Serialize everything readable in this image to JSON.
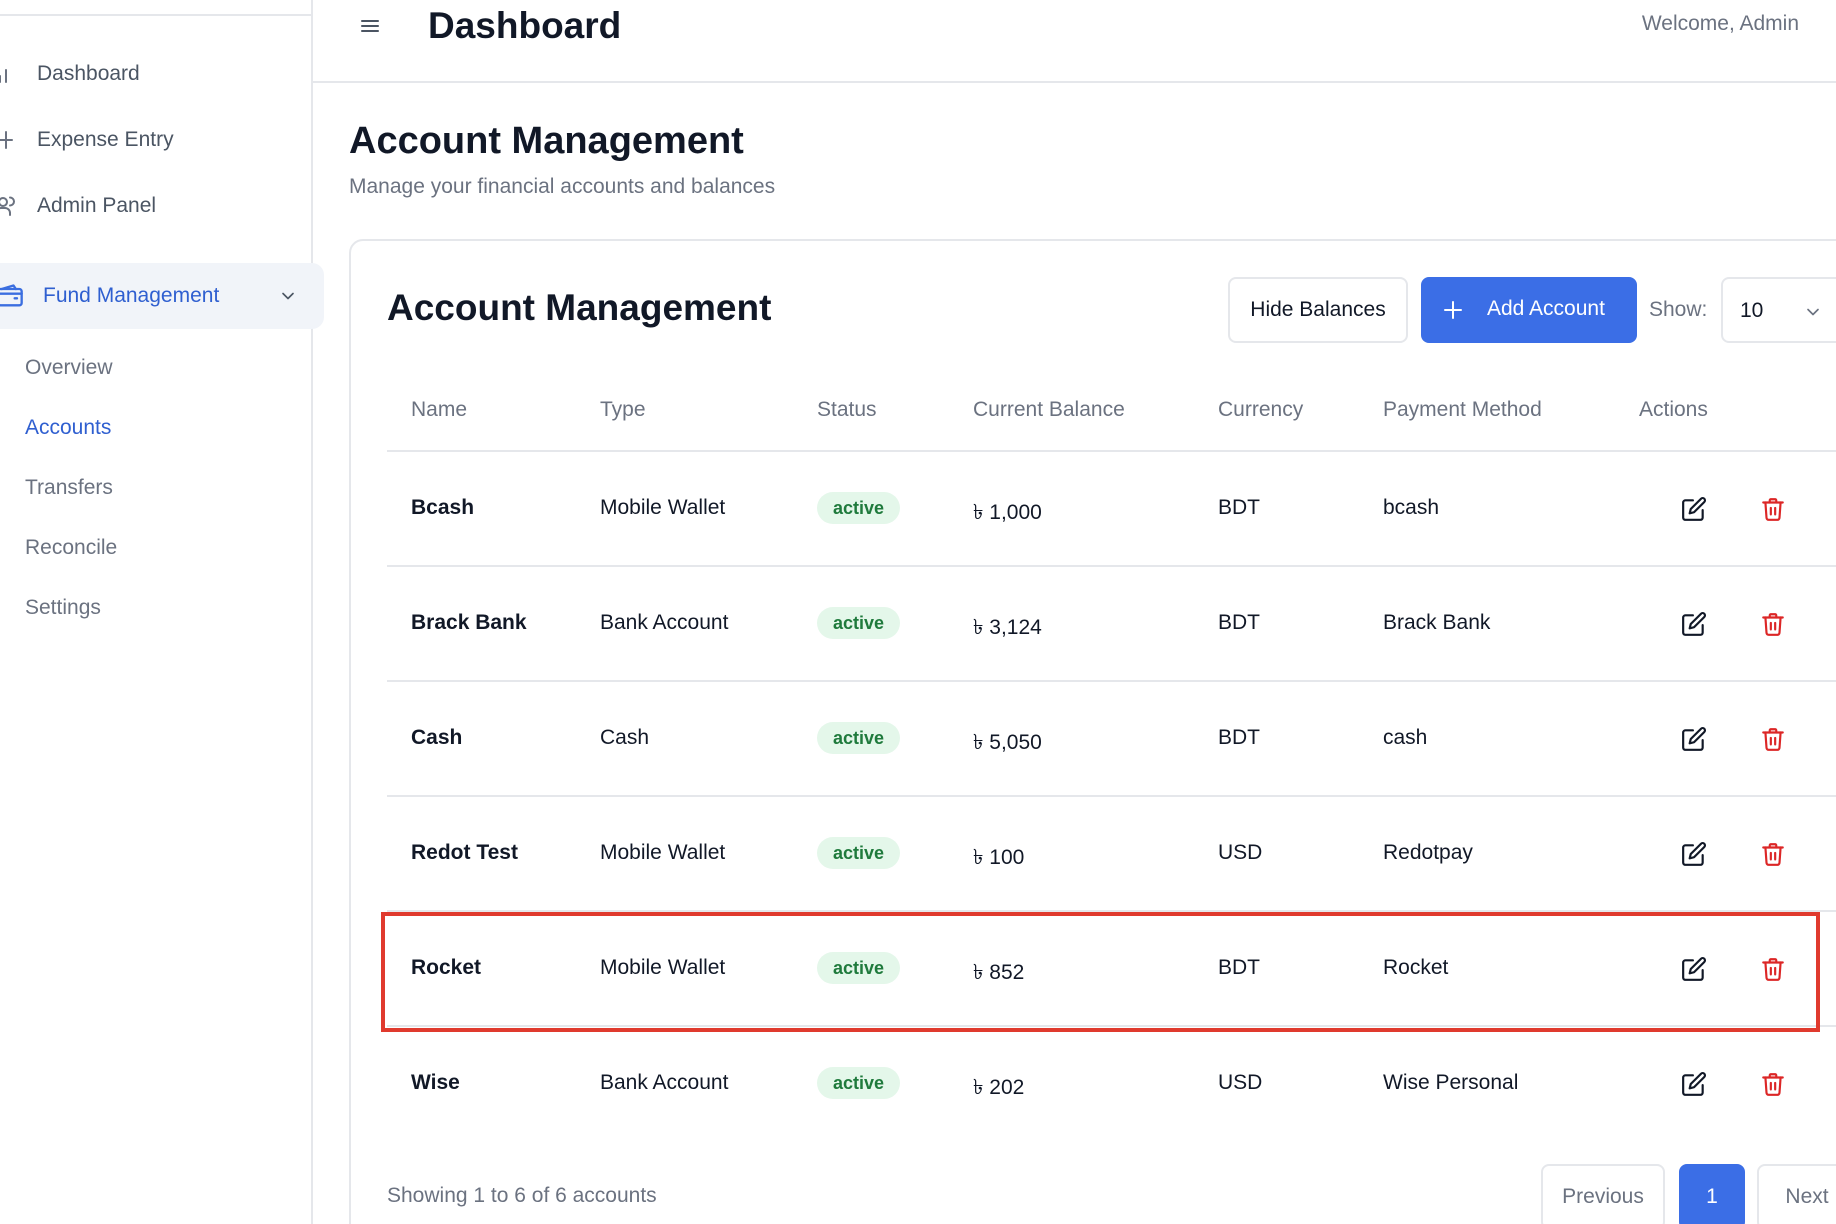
{
  "sidebar": {
    "nav": [
      {
        "label": "Dashboard",
        "icon": "bar-chart-icon"
      },
      {
        "label": "Expense Entry",
        "icon": "plus-icon"
      },
      {
        "label": "Admin Panel",
        "icon": "users-icon"
      }
    ],
    "fund": {
      "label": "Fund Management",
      "icon": "wallet-icon"
    },
    "sub_items": [
      "Overview",
      "Accounts",
      "Transfers",
      "Reconcile",
      "Settings"
    ],
    "active_sub": "Accounts"
  },
  "header": {
    "title": "Dashboard",
    "welcome": "Welcome, Admin"
  },
  "page": {
    "title": "Account Management",
    "subtitle": "Manage your financial accounts and balances"
  },
  "card": {
    "title": "Account Management",
    "hide_label": "Hide Balances",
    "add_label": "Add Account",
    "show_label": "Show:",
    "show_value": "10"
  },
  "table": {
    "columns": [
      "Name",
      "Type",
      "Status",
      "Current Balance",
      "Currency",
      "Payment Method",
      "Actions"
    ],
    "rows": [
      {
        "name": "Bcash",
        "type": "Mobile Wallet",
        "status": "active",
        "balance": "৳ 1,000",
        "currency": "BDT",
        "method": "bcash"
      },
      {
        "name": "Brack Bank",
        "type": "Bank Account",
        "status": "active",
        "balance": "৳ 3,124",
        "currency": "BDT",
        "method": "Brack Bank"
      },
      {
        "name": "Cash",
        "type": "Cash",
        "status": "active",
        "balance": "৳ 5,050",
        "currency": "BDT",
        "method": "cash"
      },
      {
        "name": "Redot Test",
        "type": "Mobile Wallet",
        "status": "active",
        "balance": "৳ 100",
        "currency": "USD",
        "method": "Redotpay"
      },
      {
        "name": "Rocket",
        "type": "Mobile Wallet",
        "status": "active",
        "balance": "৳ 852",
        "currency": "BDT",
        "method": "Rocket"
      },
      {
        "name": "Wise",
        "type": "Bank Account",
        "status": "active",
        "balance": "৳ 202",
        "currency": "USD",
        "method": "Wise Personal"
      }
    ]
  },
  "footer": {
    "showing": "Showing 1 to 6 of 6 accounts",
    "previous": "Previous",
    "page": "1",
    "next": "Next"
  },
  "colors": {
    "accent": "#3b6ee6",
    "badge_bg": "#e4f7ea",
    "badge_text": "#1f7a3c",
    "delete": "#dc2626",
    "highlight": "#e03a2e"
  }
}
